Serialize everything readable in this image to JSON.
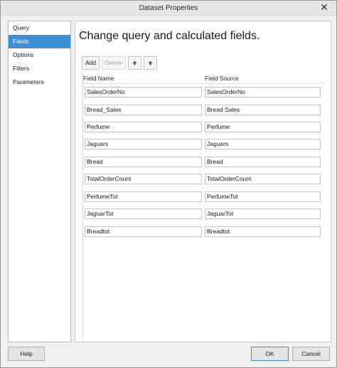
{
  "window": {
    "title": "Dataset Properties"
  },
  "nav": {
    "items": [
      {
        "label": "Query"
      },
      {
        "label": "Fields",
        "selected": true
      },
      {
        "label": "Options"
      },
      {
        "label": "Filters"
      },
      {
        "label": "Parameters"
      }
    ]
  },
  "main": {
    "heading": "Change query and calculated fields.",
    "toolbar": {
      "add_label": "Add",
      "delete_label": "Delete",
      "move_up_icon": "arrow-up-icon",
      "move_down_icon": "arrow-down-icon"
    },
    "grid": {
      "columns": [
        "Field Name",
        "Field Source"
      ],
      "rows": [
        {
          "name": "SalesOrderNo",
          "source": "SalesOrderNo"
        },
        {
          "name": "Bread_Sales",
          "source": "Bread Sales"
        },
        {
          "name": "Perfume",
          "source": "Perfume"
        },
        {
          "name": "Jaguars",
          "source": "Jaguars"
        },
        {
          "name": "Bread",
          "source": "Bread"
        },
        {
          "name": "TotalOrderCount",
          "source": "TotalOrderCount"
        },
        {
          "name": "PerfumeTot",
          "source": "PerfumeTot"
        },
        {
          "name": "JaguarTot",
          "source": "JaguarTot"
        },
        {
          "name": "Breadtot",
          "source": "Breadtot"
        }
      ]
    }
  },
  "footer": {
    "help_label": "Help",
    "ok_label": "OK",
    "cancel_label": "Cancel"
  },
  "colors": {
    "selection": "#3c8ed8",
    "window_bg": "#f0f0f0"
  }
}
